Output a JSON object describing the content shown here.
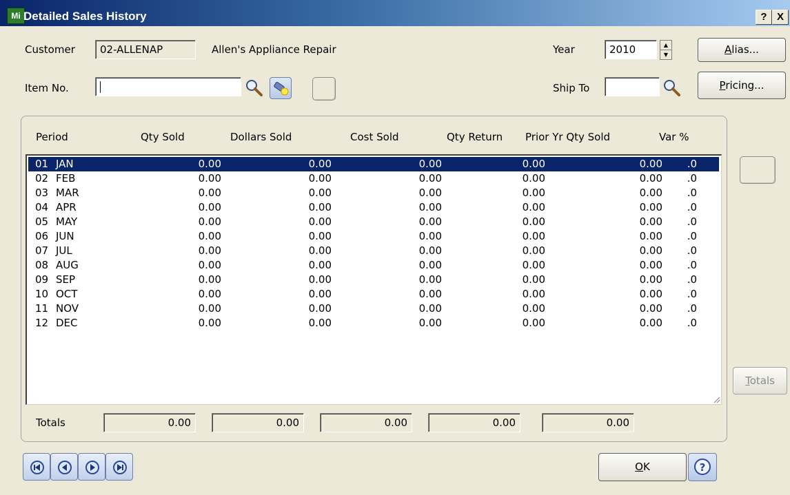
{
  "window": {
    "app_icon_text": "Mi",
    "title": "Detailed Sales History",
    "help_glyph": "?",
    "close_glyph": "X"
  },
  "header": {
    "customer_label": "Customer",
    "customer_no": "02-ALLENAP",
    "customer_name": "Allen's Appliance Repair",
    "year_label": "Year",
    "year_value": "2010",
    "item_label": "Item No.",
    "item_value": "",
    "ship_to_label": "Ship To",
    "ship_to_value": ""
  },
  "buttons": {
    "alias_mnemonic": "A",
    "alias_rest": "lias...",
    "pricing_mnemonic": "P",
    "pricing_rest": "ricing...",
    "totals_mnemonic": "T",
    "totals_rest": "otals",
    "ok_mnemonic": "O",
    "ok_rest": "K"
  },
  "table": {
    "columns": [
      "Period",
      "Qty Sold",
      "Dollars Sold",
      "Cost Sold",
      "Qty Return",
      "Prior Yr Qty Sold",
      "Var %"
    ],
    "rows": [
      {
        "num": "01",
        "month": "JAN",
        "qty_sold": "0.00",
        "dollars_sold": "0.00",
        "cost_sold": "0.00",
        "qty_return": "0.00",
        "prior_yr_qty": "0.00",
        "var_pct": ".0"
      },
      {
        "num": "02",
        "month": "FEB",
        "qty_sold": "0.00",
        "dollars_sold": "0.00",
        "cost_sold": "0.00",
        "qty_return": "0.00",
        "prior_yr_qty": "0.00",
        "var_pct": ".0"
      },
      {
        "num": "03",
        "month": "MAR",
        "qty_sold": "0.00",
        "dollars_sold": "0.00",
        "cost_sold": "0.00",
        "qty_return": "0.00",
        "prior_yr_qty": "0.00",
        "var_pct": ".0"
      },
      {
        "num": "04",
        "month": "APR",
        "qty_sold": "0.00",
        "dollars_sold": "0.00",
        "cost_sold": "0.00",
        "qty_return": "0.00",
        "prior_yr_qty": "0.00",
        "var_pct": ".0"
      },
      {
        "num": "05",
        "month": "MAY",
        "qty_sold": "0.00",
        "dollars_sold": "0.00",
        "cost_sold": "0.00",
        "qty_return": "0.00",
        "prior_yr_qty": "0.00",
        "var_pct": ".0"
      },
      {
        "num": "06",
        "month": "JUN",
        "qty_sold": "0.00",
        "dollars_sold": "0.00",
        "cost_sold": "0.00",
        "qty_return": "0.00",
        "prior_yr_qty": "0.00",
        "var_pct": ".0"
      },
      {
        "num": "07",
        "month": "JUL",
        "qty_sold": "0.00",
        "dollars_sold": "0.00",
        "cost_sold": "0.00",
        "qty_return": "0.00",
        "prior_yr_qty": "0.00",
        "var_pct": ".0"
      },
      {
        "num": "08",
        "month": "AUG",
        "qty_sold": "0.00",
        "dollars_sold": "0.00",
        "cost_sold": "0.00",
        "qty_return": "0.00",
        "prior_yr_qty": "0.00",
        "var_pct": ".0"
      },
      {
        "num": "09",
        "month": "SEP",
        "qty_sold": "0.00",
        "dollars_sold": "0.00",
        "cost_sold": "0.00",
        "qty_return": "0.00",
        "prior_yr_qty": "0.00",
        "var_pct": ".0"
      },
      {
        "num": "10",
        "month": "OCT",
        "qty_sold": "0.00",
        "dollars_sold": "0.00",
        "cost_sold": "0.00",
        "qty_return": "0.00",
        "prior_yr_qty": "0.00",
        "var_pct": ".0"
      },
      {
        "num": "11",
        "month": "NOV",
        "qty_sold": "0.00",
        "dollars_sold": "0.00",
        "cost_sold": "0.00",
        "qty_return": "0.00",
        "prior_yr_qty": "0.00",
        "var_pct": ".0"
      },
      {
        "num": "12",
        "month": "DEC",
        "qty_sold": "0.00",
        "dollars_sold": "0.00",
        "cost_sold": "0.00",
        "qty_return": "0.00",
        "prior_yr_qty": "0.00",
        "var_pct": ".0"
      }
    ],
    "selected_row": 0,
    "totals_label": "Totals",
    "totals": {
      "qty_sold": "0.00",
      "dollars_sold": "0.00",
      "cost_sold": "0.00",
      "qty_return": "0.00",
      "prior_yr_qty": "0.00"
    }
  },
  "icons": {
    "search": "magnifier-icon",
    "lookup_light": "flashlight-icon",
    "nav_first": "first-record-icon",
    "nav_prev": "previous-record-icon",
    "nav_next": "next-record-icon",
    "nav_last": "last-record-icon",
    "help": "help-icon"
  },
  "colors": {
    "selection": "#0a246a",
    "window_bg": "#ece9d8"
  }
}
